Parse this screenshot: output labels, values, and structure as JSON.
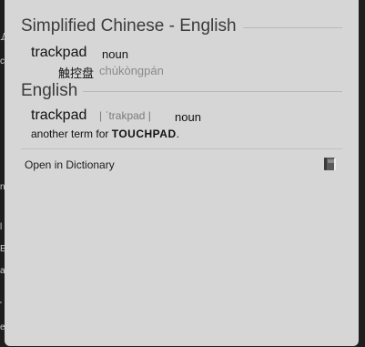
{
  "panel": {
    "sections": [
      {
        "title": "Simplified Chinese - English",
        "entry": {
          "headword": "trackpad",
          "pos": "noun",
          "translation": "触控盘",
          "pinyin": "chùkòngpán"
        }
      },
      {
        "title": "English",
        "entry": {
          "headword": "trackpad",
          "pronunciation": "| ˈtrakpad |",
          "pos": "noun",
          "definition_prefix": "another term for ",
          "definition_ref": "TOUCHPAD",
          "definition_suffix": "."
        }
      }
    ],
    "footer": {
      "open_label": "Open in Dictionary",
      "icon": "dictionary-app-icon"
    }
  },
  "background": {
    "visible_glyphs": [
      "ム",
      "c",
      "n",
      "l",
      "E",
      "a",
      "'",
      "e"
    ]
  }
}
